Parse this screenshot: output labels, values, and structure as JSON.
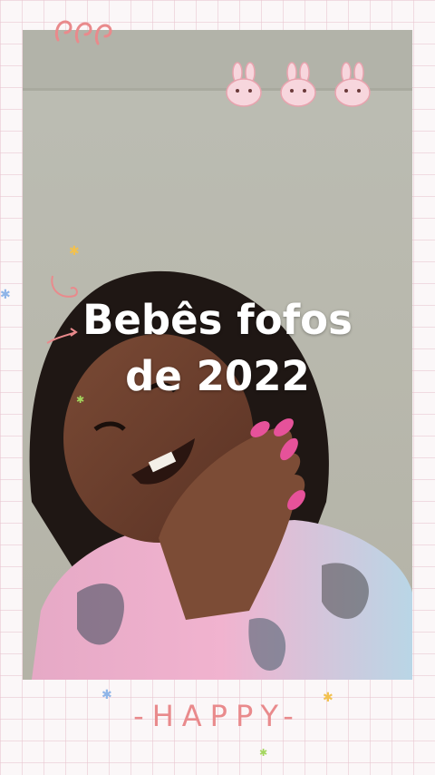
{
  "overlay": {
    "title_line1": "Bebês fofos",
    "title_line2": "de 2022",
    "bottom_text": "-HAPPY-"
  },
  "decorations": {
    "top_left": "spiral-swirls",
    "top_right": "bunny-faces",
    "stars": [
      "yellow-star",
      "blue-star",
      "green-star",
      "blue-star",
      "yellow-star",
      "green-star"
    ]
  },
  "colors": {
    "accent_pink": "#e98a8c",
    "grid_line": "#e8c4ce",
    "background": "#fbf7f8",
    "title_text": "#ffffff"
  }
}
